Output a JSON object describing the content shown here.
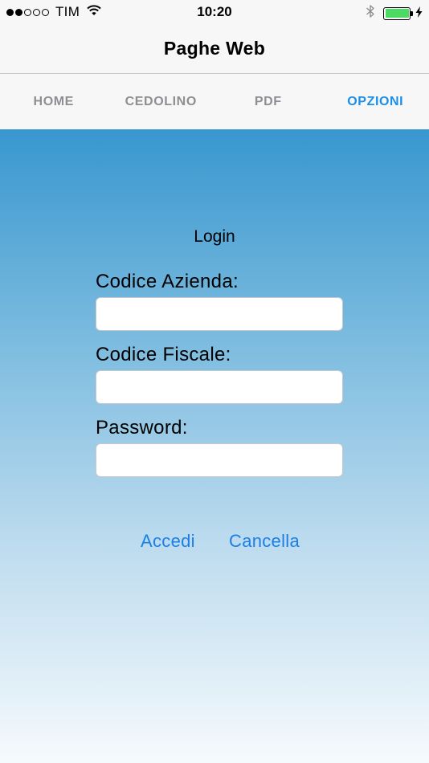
{
  "status_bar": {
    "signal_dots": {
      "full": 2,
      "empty": 3
    },
    "carrier": "TIM",
    "time": "10:20",
    "icons": [
      "wifi-icon",
      "bluetooth-icon",
      "battery-icon",
      "charging-bolt-icon"
    ],
    "battery_level": 1.0,
    "battery_color": "#4cd964"
  },
  "nav": {
    "title": "Paghe Web"
  },
  "tabs": [
    {
      "label": "HOME",
      "active": false
    },
    {
      "label": "CEDOLINO",
      "active": false
    },
    {
      "label": "PDF",
      "active": false
    },
    {
      "label": "OPZIONI",
      "active": true
    }
  ],
  "login": {
    "title": "Login",
    "fields": [
      {
        "label": "Codice Azienda:",
        "value": "",
        "placeholder": ""
      },
      {
        "label": "Codice Fiscale:",
        "value": "",
        "placeholder": ""
      },
      {
        "label": "Password:",
        "value": "",
        "placeholder": ""
      }
    ],
    "accedi_label": "Accedi",
    "cancella_label": "Cancella"
  },
  "colors": {
    "accent": "#1b8eea",
    "inactive_tab": "#8e8e93",
    "gradient_top": "#3897cf",
    "gradient_bottom": "#f6fafd"
  }
}
